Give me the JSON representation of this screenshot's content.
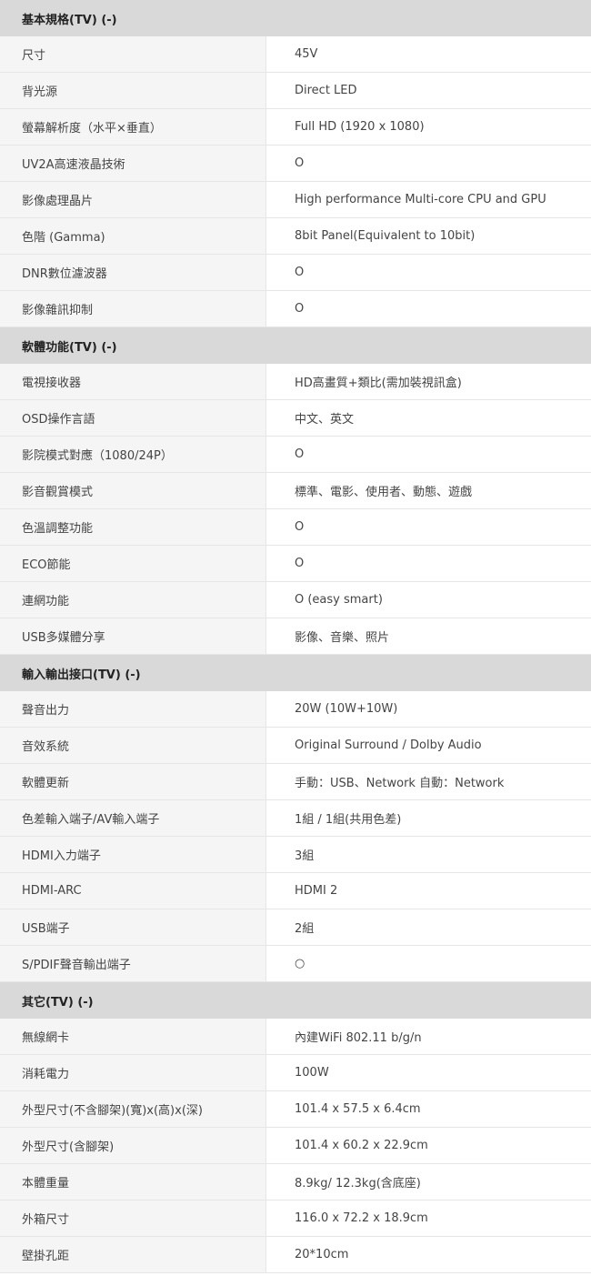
{
  "sections": [
    {
      "title": "基本規格(TV) (-)",
      "rows": [
        {
          "label": "尺寸",
          "value": "45V"
        },
        {
          "label": "背光源",
          "value": "Direct LED"
        },
        {
          "label": "螢幕解析度（水平×垂直）",
          "value": "Full HD (1920 x 1080)"
        },
        {
          "label": "UV2A高速液晶技術",
          "value": "O"
        },
        {
          "label": "影像處理晶片",
          "value": "High performance Multi-core CPU and GPU"
        },
        {
          "label": "色階 (Gamma)",
          "value": "8bit Panel(Equivalent to 10bit)"
        },
        {
          "label": "DNR數位濾波器",
          "value": "O"
        },
        {
          "label": "影像雜訊抑制",
          "value": "O"
        }
      ]
    },
    {
      "title": "軟體功能(TV) (-)",
      "rows": [
        {
          "label": "電視接收器",
          "value": "HD高畫質+類比(需加裝視訊盒)"
        },
        {
          "label": "OSD操作言語",
          "value": "中文、英文"
        },
        {
          "label": "影院模式對應（1080/24P）",
          "value": "O"
        },
        {
          "label": "影音觀賞模式",
          "value": "標準、電影、使用者、動態、遊戲"
        },
        {
          "label": "色溫調整功能",
          "value": "O"
        },
        {
          "label": "ECO節能",
          "value": "O"
        },
        {
          "label": "連網功能",
          "value": "O (easy smart)"
        },
        {
          "label": "USB多媒體分享",
          "value": "影像、音樂、照片"
        }
      ]
    },
    {
      "title": "輸入輸出接口(TV) (-)",
      "rows": [
        {
          "label": "聲音出力",
          "value": "20W (10W+10W)"
        },
        {
          "label": "音效系統",
          "value": "Original Surround / Dolby Audio"
        },
        {
          "label": "軟體更新",
          "value": "手動：USB、Network 自動：Network"
        },
        {
          "label": "色差輸入端子/AV輸入端子",
          "value": "1組 / 1組(共用色差)"
        },
        {
          "label": "HDMI入力端子",
          "value": "3組"
        },
        {
          "label": "HDMI-ARC",
          "value": "HDMI 2"
        },
        {
          "label": "USB端子",
          "value": "2組"
        },
        {
          "label": "S/PDIF聲音輸出端子",
          "value": "○"
        }
      ]
    },
    {
      "title": "其它(TV) (-)",
      "rows": [
        {
          "label": "無線網卡",
          "value": "內建WiFi 802.11 b/g/n"
        },
        {
          "label": "消耗電力",
          "value": "100W"
        },
        {
          "label": "外型尺寸(不含腳架)(寬)x(高)x(深)",
          "value": "101.4 x 57.5 x 6.4cm"
        },
        {
          "label": "外型尺寸(含腳架)",
          "value": "101.4 x 60.2 x 22.9cm"
        },
        {
          "label": "本體重量",
          "value": "8.9kg/ 12.3kg(含底座)"
        },
        {
          "label": "外箱尺寸",
          "value": "116.0 x 72.2 x 18.9cm"
        },
        {
          "label": "壁掛孔距",
          "value": "20*10cm"
        }
      ]
    }
  ]
}
